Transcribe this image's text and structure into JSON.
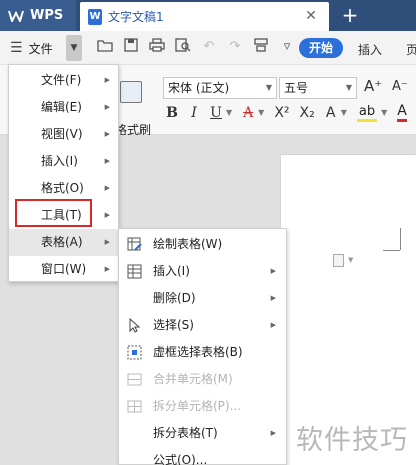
{
  "titlebar": {
    "app_label": "WPS",
    "doc_tab_label": "文字文稿1",
    "close_glyph": "✕",
    "new_tab_glyph": "+"
  },
  "toolbar": {
    "file_label": "文件",
    "start_tab": "开始",
    "insert_tab": "插入",
    "more_tab": "页"
  },
  "ribbon": {
    "format_painter_label": "格式刷",
    "font_name": "宋体 (正文)",
    "font_size": "五号",
    "grow_font": "A⁺",
    "shrink_font": "A⁻",
    "bold": "B",
    "italic": "I",
    "underline": "U",
    "strikethrough": "A",
    "superscript": "X²",
    "subscript": "X₂",
    "text_effect": "A",
    "highlight": "ab",
    "font_color": "A"
  },
  "main_menu": {
    "items": [
      {
        "label": "文件(F)"
      },
      {
        "label": "编辑(E)"
      },
      {
        "label": "视图(V)"
      },
      {
        "label": "插入(I)"
      },
      {
        "label": "格式(O)"
      },
      {
        "label": "工具(T)"
      },
      {
        "label": "表格(A)"
      },
      {
        "label": "窗口(W)"
      }
    ]
  },
  "table_submenu": {
    "items": [
      {
        "label": "绘制表格(W)"
      },
      {
        "label": "插入(I)"
      },
      {
        "label": "删除(D)"
      },
      {
        "label": "选择(S)"
      },
      {
        "label": "虚框选择表格(B)"
      },
      {
        "label": "合并单元格(M)"
      },
      {
        "label": "拆分单元格(P)..."
      },
      {
        "label": "拆分表格(T)"
      },
      {
        "label": "公式(O)..."
      }
    ]
  },
  "watermark": "软件技巧",
  "colors": {
    "titlebar_bg": "#2f4e7a",
    "accent_blue": "#2b6fd8",
    "highlight_red": "#d42a2a"
  }
}
